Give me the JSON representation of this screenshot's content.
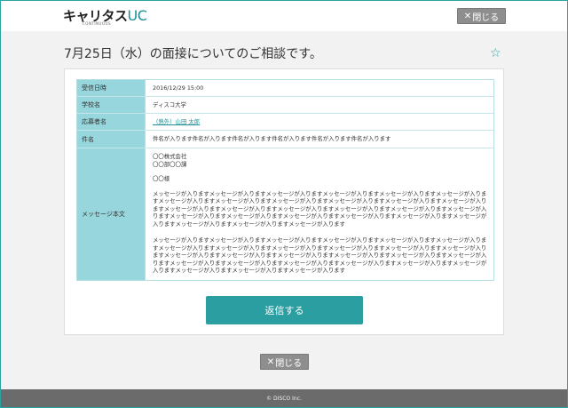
{
  "header": {
    "logo_text": "キャリタス",
    "logo_uc": "UC",
    "logo_sub": "CONTINUOUS",
    "close_label": "閉じる"
  },
  "page": {
    "title": "7月25日（水）の面接についてのご相談です。"
  },
  "detail": {
    "received_label": "受信日時",
    "received_value": "2016/12/29 15:00",
    "school_label": "学校名",
    "school_value": "ディスコ大学",
    "applicant_label": "応募者名",
    "applicant_value": "（熱外）山田 太郎",
    "subject_label": "件名",
    "subject_value": "件名が入ります件名が入ります件名が入ります件名が入ります件名が入ります件名が入ります",
    "body_label": "メッセージ本文",
    "body_company": "〇〇株式会社",
    "body_dept": "〇〇部〇〇課",
    "body_name": "〇〇様",
    "body_para1": "メッセージが入りますメッセージが入りますメッセージが入りますメッセージが入りますメッセージが入りますメッセージが入りますメッセージが入りますメッセージが入りますメッセージが入りますメッセージが入りますメッセージが入りますメッセージが入りますメッセージが入りますメッセージが入りますメッセージが入りますメッセージが入りますメッセージが入りますメッセージが入りますメッセージが入りますメッセージが入りますメッセージが入りますメッセージが入りますメッセージが入りますメッセージが入りますメッセージが入りますメッセージが入りますメッセージが入ります",
    "body_para2": "メッセージが入りますメッセージが入りますメッセージが入りますメッセージが入りますメッセージが入りますメッセージが入りますメッセージが入りますメッセージが入りますメッセージが入りますメッセージが入りますメッセージが入りますメッセージが入りますメッセージが入りますメッセージが入りますメッセージが入りますメッセージが入りますメッセージが入りますメッセージが入りますメッセージが入りますメッセージが入りますメッセージが入りますメッセージが入りますメッセージが入りますメッセージが入りますメッセージが入りますメッセージが入りますメッセージが入ります"
  },
  "actions": {
    "reply_label": "返信する",
    "close_label": "閉じる"
  },
  "footer": {
    "copyright": "© DISCO Inc."
  },
  "colors": {
    "accent": "#2a9ea1",
    "header_cell": "#96d6dc",
    "close_button": "#8e8e8e",
    "footer": "#6b6b6b"
  },
  "icons": {
    "star": "star-icon",
    "close": "close-icon"
  }
}
